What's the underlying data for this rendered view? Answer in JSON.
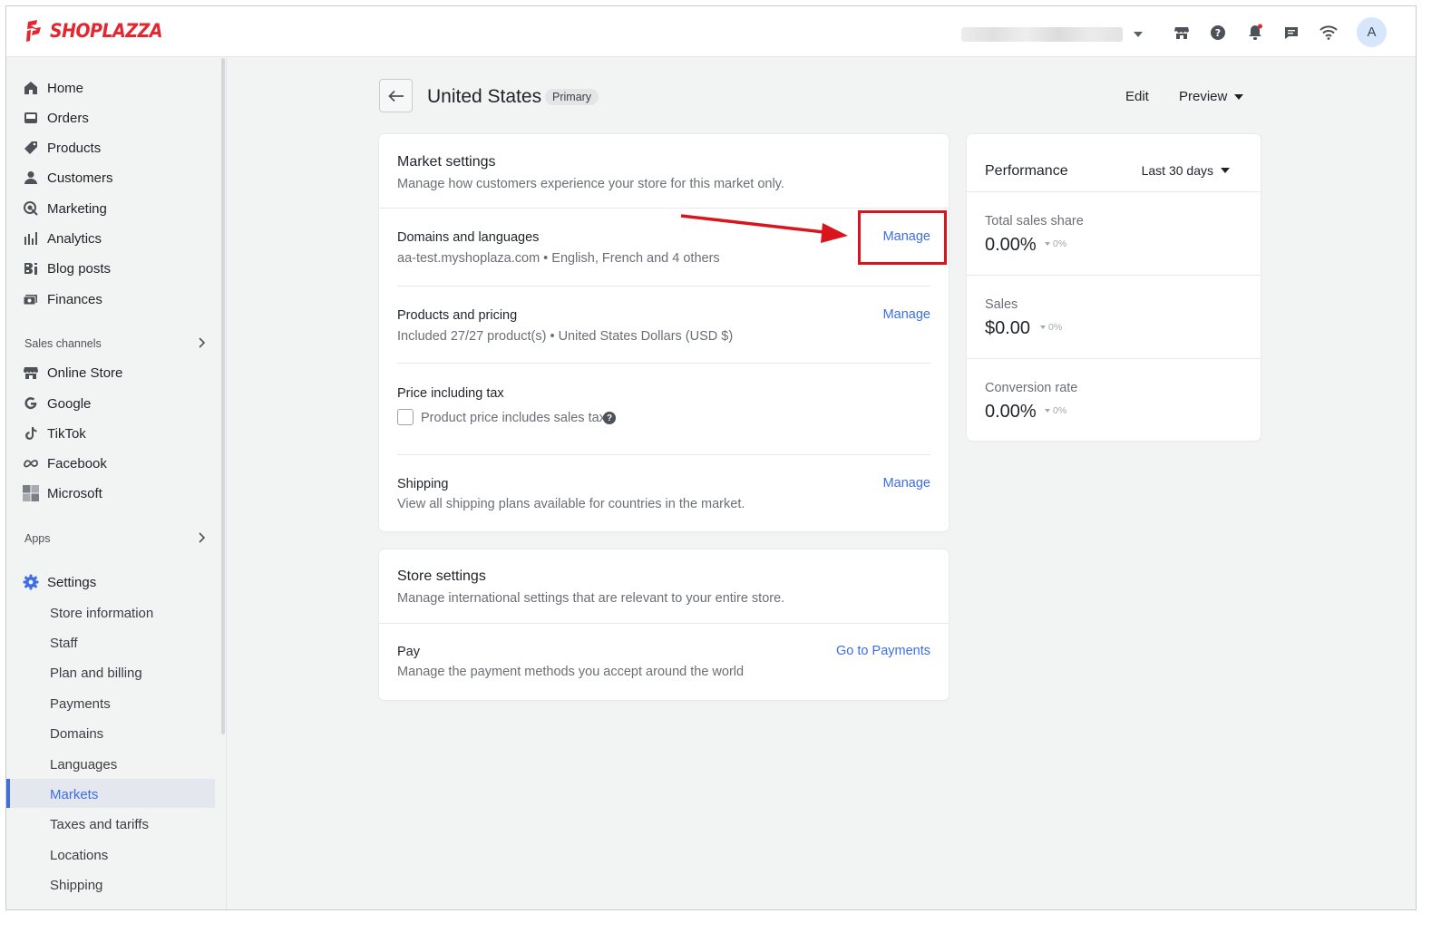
{
  "app": {
    "logo_text": "SHOPLAZZA",
    "brand_color": "#e3262f",
    "accent_color": "#3d6ee6",
    "annotation_color": "#d9141c"
  },
  "topbar": {
    "avatar_initial": "A",
    "icons": [
      "store-icon",
      "help-icon",
      "bell-icon",
      "chat-icon",
      "wifi-icon"
    ]
  },
  "sidebar": {
    "main": [
      {
        "label": "Home",
        "icon": "home-icon"
      },
      {
        "label": "Orders",
        "icon": "orders-icon"
      },
      {
        "label": "Products",
        "icon": "tag-icon"
      },
      {
        "label": "Customers",
        "icon": "person-icon"
      },
      {
        "label": "Marketing",
        "icon": "marketing-icon"
      },
      {
        "label": "Analytics",
        "icon": "bar-chart-icon"
      },
      {
        "label": "Blog posts",
        "icon": "blog-icon"
      },
      {
        "label": "Finances",
        "icon": "finance-icon"
      }
    ],
    "sales_channels_label": "Sales channels",
    "channels": [
      {
        "label": "Online Store",
        "icon": "store-icon"
      },
      {
        "label": "Google",
        "icon": "google-icon"
      },
      {
        "label": "TikTok",
        "icon": "tiktok-icon"
      },
      {
        "label": "Facebook",
        "icon": "meta-icon"
      },
      {
        "label": "Microsoft",
        "icon": "microsoft-icon"
      }
    ],
    "apps_label": "Apps",
    "settings_label": "Settings",
    "settings_items": [
      "Store information",
      "Staff",
      "Plan and billing",
      "Payments",
      "Domains",
      "Languages",
      "Markets",
      "Taxes and tariffs",
      "Locations",
      "Shipping"
    ],
    "active_item": "Markets"
  },
  "header": {
    "title": "United States",
    "badge": "Primary",
    "edit_label": "Edit",
    "preview_label": "Preview"
  },
  "market_settings": {
    "title": "Market settings",
    "subtitle": "Manage how customers experience your store for this market only.",
    "rows": [
      {
        "title": "Domains and languages",
        "sub": "aa-test.myshoplaza.com • English, French and 4 others",
        "action": "Manage"
      },
      {
        "title": "Products and pricing",
        "sub": "Included 27/27 product(s) • United States Dollars (USD $)",
        "action": "Manage"
      }
    ],
    "tax": {
      "title": "Price including tax",
      "checkbox_label": "Product price includes sales tax",
      "checked": false
    },
    "shipping": {
      "title": "Shipping",
      "sub": "View all shipping plans available for countries in the market.",
      "action": "Manage"
    }
  },
  "store_settings": {
    "title": "Store settings",
    "subtitle": "Manage international settings that are relevant to your entire store.",
    "pay": {
      "title": "Pay",
      "sub": "Manage the payment methods you accept around the world",
      "action": "Go to Payments"
    }
  },
  "performance": {
    "title": "Performance",
    "range": "Last 30 days",
    "metrics": [
      {
        "label": "Total sales share",
        "value": "0.00%",
        "delta": "0%"
      },
      {
        "label": "Sales",
        "value": "$0.00",
        "delta": "0%"
      },
      {
        "label": "Conversion rate",
        "value": "0.00%",
        "delta": "0%"
      }
    ]
  }
}
